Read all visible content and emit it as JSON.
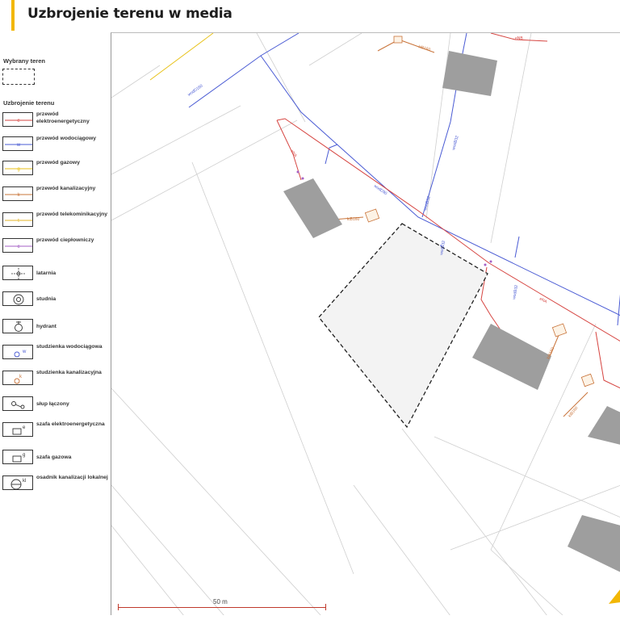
{
  "header": {
    "title": "Uzbrojenie terenu w media"
  },
  "legend": {
    "selected_heading": "Wybrany teren",
    "utilities_heading": "Uzbrojenie terenu",
    "items": [
      {
        "label": "przewód elektroenergetyczny",
        "symbol": "e",
        "color": "#d64541",
        "icon": "line"
      },
      {
        "label": "przewód wodociągowy",
        "symbol": "w",
        "color": "#4a5bd4",
        "icon": "line"
      },
      {
        "label": "przewód gazowy",
        "symbol": "g",
        "color": "#e8c21a",
        "icon": "line"
      },
      {
        "label": "przewód kanalizacyjny",
        "symbol": "k",
        "color": "#c9743a",
        "icon": "line"
      },
      {
        "label": "przewód telekominikacyjny",
        "symbol": "t",
        "color": "#e3b52a",
        "icon": "line"
      },
      {
        "label": "przewód ciepłowniczy",
        "symbol": "c",
        "color": "#a45fc4",
        "icon": "line"
      },
      {
        "label": "latarnia",
        "icon": "lamp-icon"
      },
      {
        "label": "studnia",
        "icon": "well-icon"
      },
      {
        "label": "hydrant",
        "icon": "hydrant-icon"
      },
      {
        "label": "studzienka wodociągowa",
        "symbol": "w",
        "icon": "water-manhole-icon"
      },
      {
        "label": "studzienka kanalizacyjna",
        "symbol": "k",
        "icon": "sewer-manhole-icon"
      },
      {
        "label": "słup łączony",
        "icon": "pole-icon"
      },
      {
        "label": "szafa elektroenergetyczna",
        "symbol": "e",
        "icon": "electric-cabinet-icon"
      },
      {
        "label": "szafa gazowa",
        "symbol": "g",
        "icon": "gas-cabinet-icon"
      },
      {
        "label": "osadnik kanalizacji lokalnej",
        "symbol": "kl",
        "icon": "septic-tank-icon"
      }
    ]
  },
  "map": {
    "scale_label": "50 m",
    "line_labels": {
      "water1": "wodD160",
      "water2": "wodD90",
      "water3": "wodB32",
      "water4": "wodB32",
      "water5": "wodB32",
      "water6": "wodB32",
      "elec1": "eNA",
      "elec2": "eNA",
      "elec3": "eNB",
      "sewer1": "kiB160",
      "sewer2": "kiB160",
      "sewer3": "kiB160",
      "sewer4": "kiB160"
    },
    "colors": {
      "electric": "#d64541",
      "water": "#4a5bd4",
      "gas": "#e8c21a",
      "sewer": "#c9743a",
      "building": "#9e9e9e",
      "parcel_fill": "#f3f3f3",
      "north_arrow": "#f2b705"
    }
  }
}
